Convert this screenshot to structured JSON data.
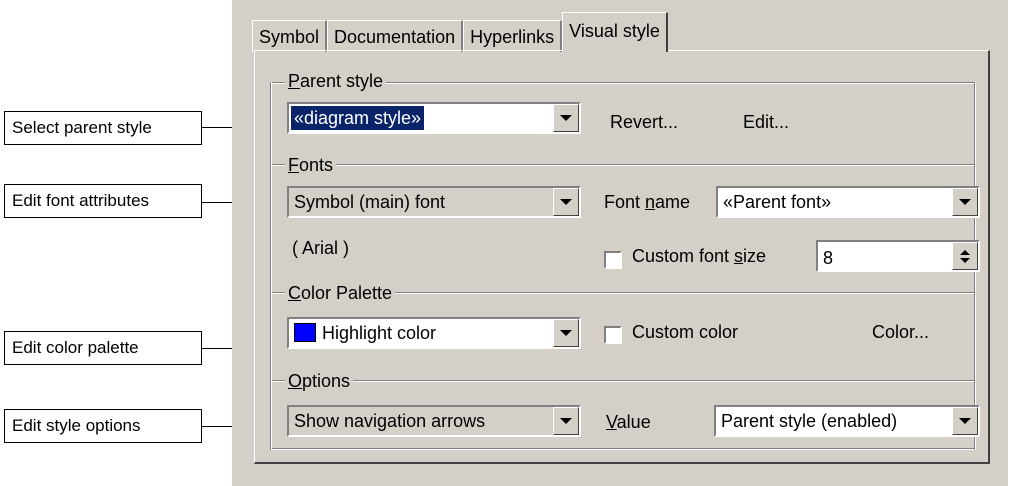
{
  "callouts": {
    "parent_style": "Select parent style",
    "fonts": "Edit font attributes",
    "color_palette": "Edit color palette",
    "options": "Edit style options"
  },
  "tabs": [
    {
      "label": "Symbol",
      "active": false
    },
    {
      "label": "Documentation",
      "active": false
    },
    {
      "label": "Hyperlinks",
      "active": false
    },
    {
      "label": "Visual style",
      "active": true
    }
  ],
  "parent_style": {
    "group_label_first": "P",
    "group_label_rest": "arent style",
    "selected": "«diagram style»",
    "revert_label": "Revert...",
    "edit_label": "Edit..."
  },
  "fonts": {
    "group_label_first": "F",
    "group_label_rest": "onts",
    "font_target": "Symbol (main) font",
    "inherited_font": "( Arial )",
    "font_name_label_a": "Font ",
    "font_name_label_u": "n",
    "font_name_label_b": "ame",
    "font_name_value": "«Parent font»",
    "custom_size_label_a": "Custom font ",
    "custom_size_label_u": "s",
    "custom_size_label_b": "ize",
    "custom_size_checked": false,
    "size_value": "8"
  },
  "color_palette": {
    "group_label_first": "C",
    "group_label_rest": "olor Palette",
    "selected": "Highlight color",
    "swatch_color": "#0000ff",
    "custom_color_label": "Custom color",
    "custom_color_checked": false,
    "color_button_label": "Color..."
  },
  "options": {
    "group_label_first": "O",
    "group_label_rest": "ptions",
    "selected": "Show navigation arrows",
    "value_label_u": "V",
    "value_label_rest": "alue",
    "value_selected": "Parent style (enabled)"
  },
  "colors": {
    "dialog_bg": "#d4d0c8",
    "selection_bg": "#0a246a"
  }
}
